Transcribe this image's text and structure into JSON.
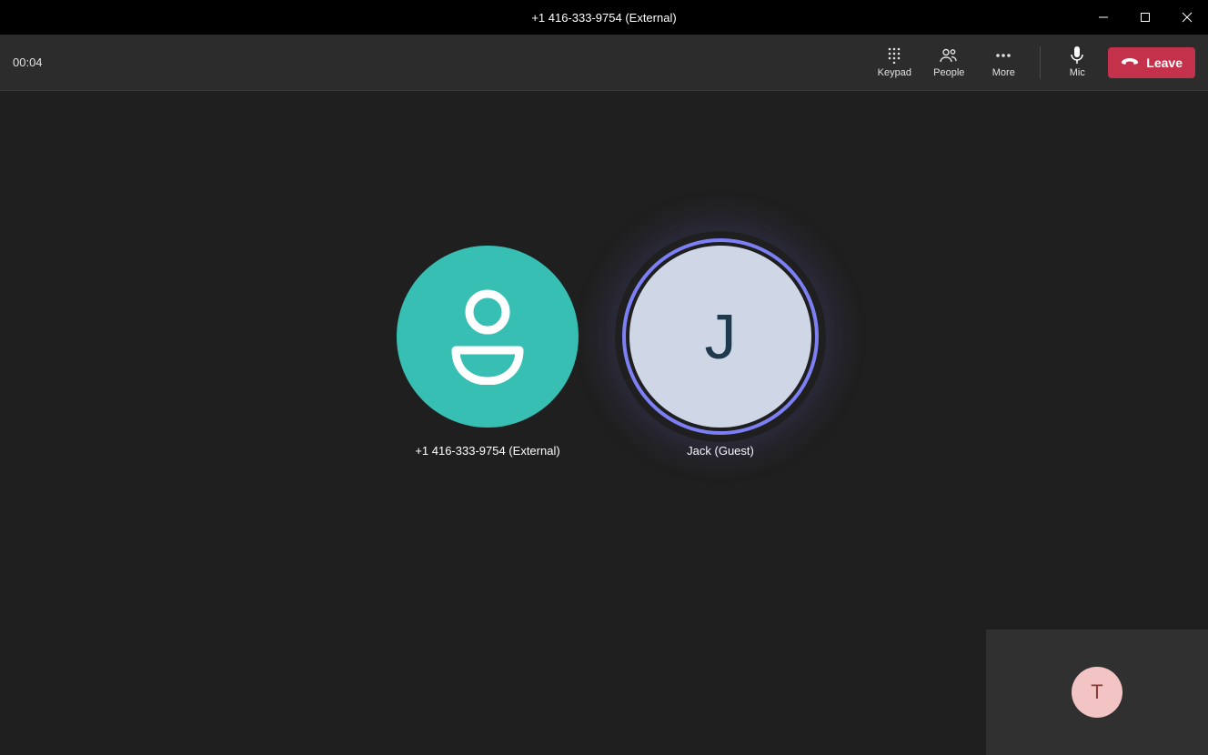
{
  "titlebar": {
    "title": "+1 416-333-9754 (External)"
  },
  "toolbar": {
    "timer": "00:04",
    "keypad_label": "Keypad",
    "people_label": "People",
    "more_label": "More",
    "mic_label": "Mic",
    "leave_label": "Leave"
  },
  "participants": [
    {
      "name": "+1 416-333-9754 (External)",
      "initial": ""
    },
    {
      "name": "Jack (Guest)",
      "initial": "J"
    }
  ],
  "self": {
    "initial": "T"
  }
}
